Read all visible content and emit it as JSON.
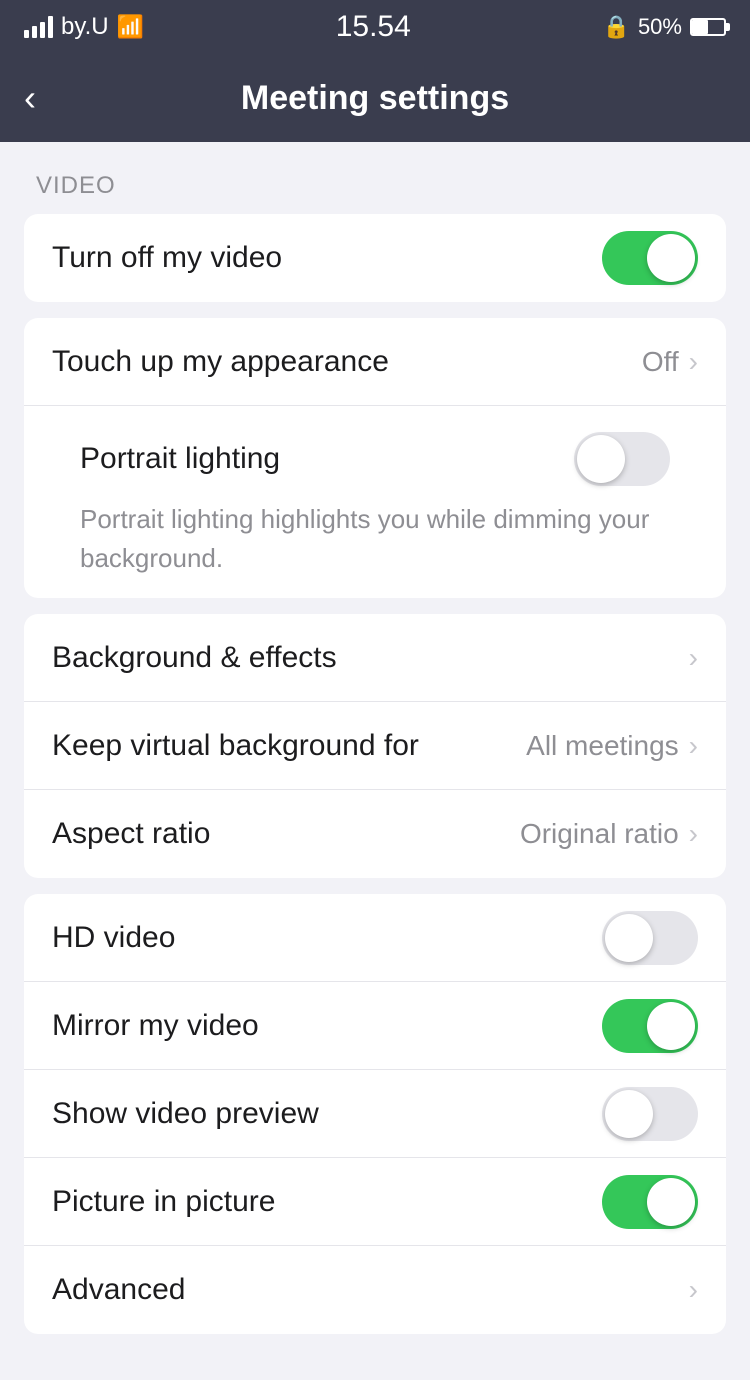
{
  "statusBar": {
    "carrier": "by.U",
    "time": "15.54",
    "battery": "50%",
    "lockIcon": "🔒"
  },
  "header": {
    "title": "Meeting settings",
    "backLabel": "‹"
  },
  "sections": [
    {
      "id": "video",
      "label": "VIDEO",
      "groups": [
        {
          "id": "group1",
          "rows": [
            {
              "id": "turn-off-video",
              "label": "Turn off my video",
              "type": "toggle",
              "state": "on"
            }
          ]
        },
        {
          "id": "group2",
          "rows": [
            {
              "id": "touch-up",
              "label": "Touch up my appearance",
              "type": "nav",
              "value": "Off"
            },
            {
              "id": "portrait-lighting",
              "label": "Portrait lighting",
              "type": "toggle-with-desc",
              "state": "off",
              "description": "Portrait lighting highlights you while dimming your background."
            }
          ]
        },
        {
          "id": "group3",
          "rows": [
            {
              "id": "background-effects",
              "label": "Background & effects",
              "type": "nav",
              "value": ""
            },
            {
              "id": "keep-virtual-bg",
              "label": "Keep virtual background for",
              "type": "nav",
              "value": "All meetings"
            },
            {
              "id": "aspect-ratio",
              "label": "Aspect ratio",
              "type": "nav",
              "value": "Original ratio"
            }
          ]
        },
        {
          "id": "group4",
          "rows": [
            {
              "id": "hd-video",
              "label": "HD video",
              "type": "toggle",
              "state": "off"
            },
            {
              "id": "mirror-video",
              "label": "Mirror my video",
              "type": "toggle",
              "state": "on"
            },
            {
              "id": "show-preview",
              "label": "Show video preview",
              "type": "toggle",
              "state": "off"
            },
            {
              "id": "picture-in-picture",
              "label": "Picture in picture",
              "type": "toggle",
              "state": "on"
            },
            {
              "id": "advanced",
              "label": "Advanced",
              "type": "nav",
              "value": ""
            }
          ]
        }
      ]
    }
  ]
}
